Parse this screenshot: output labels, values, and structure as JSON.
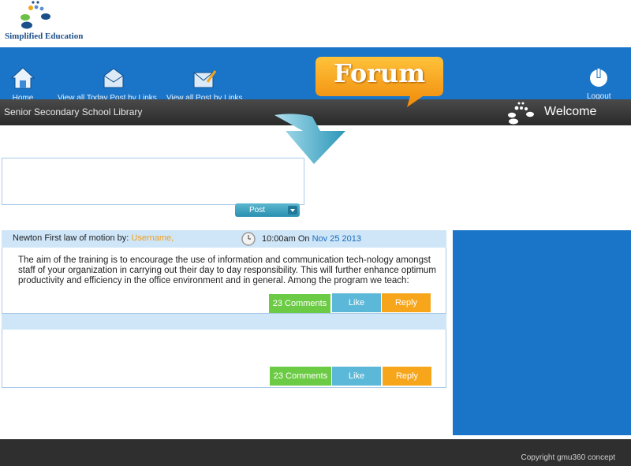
{
  "brand": {
    "name": "Simplified Education"
  },
  "nav": {
    "home_label": "Home",
    "today_posts_label": "View all Today Post by Links",
    "all_posts_label": "View all Post by Links",
    "logout_label": "Logout"
  },
  "forum_badge": "Forum",
  "subbar": {
    "title": "Senior Secondary School Library",
    "welcome": "Welcome"
  },
  "compose": {
    "placeholder": "",
    "post_button": "Post"
  },
  "posts": [
    {
      "title": "Newton First law of motion by: ",
      "username": "Username,",
      "time": "10:00am On ",
      "date": "Nov 25 2013",
      "body": "The aim of the training is to encourage the use of information and communication tech-nology amongst staff of your organization in carrying out their day to day responsibility. This will further enhance optimum productivity and efficiency in the office environment and in general.   Among the program we teach:",
      "comments_label": "23 Comments",
      "like_label": "Like",
      "reply_label": "Reply"
    },
    {
      "comments_label": "23 Comments",
      "like_label": "Like",
      "reply_label": "Reply"
    }
  ],
  "footer": {
    "copyright": "Copyright gmu360 concept"
  },
  "colors": {
    "primary_blue": "#1a75c9",
    "light_blue": "#cfe6f8",
    "green": "#6ccb45",
    "teal": "#5bb8d9",
    "orange": "#f7a61c",
    "forum_orange": "#f5a623"
  }
}
